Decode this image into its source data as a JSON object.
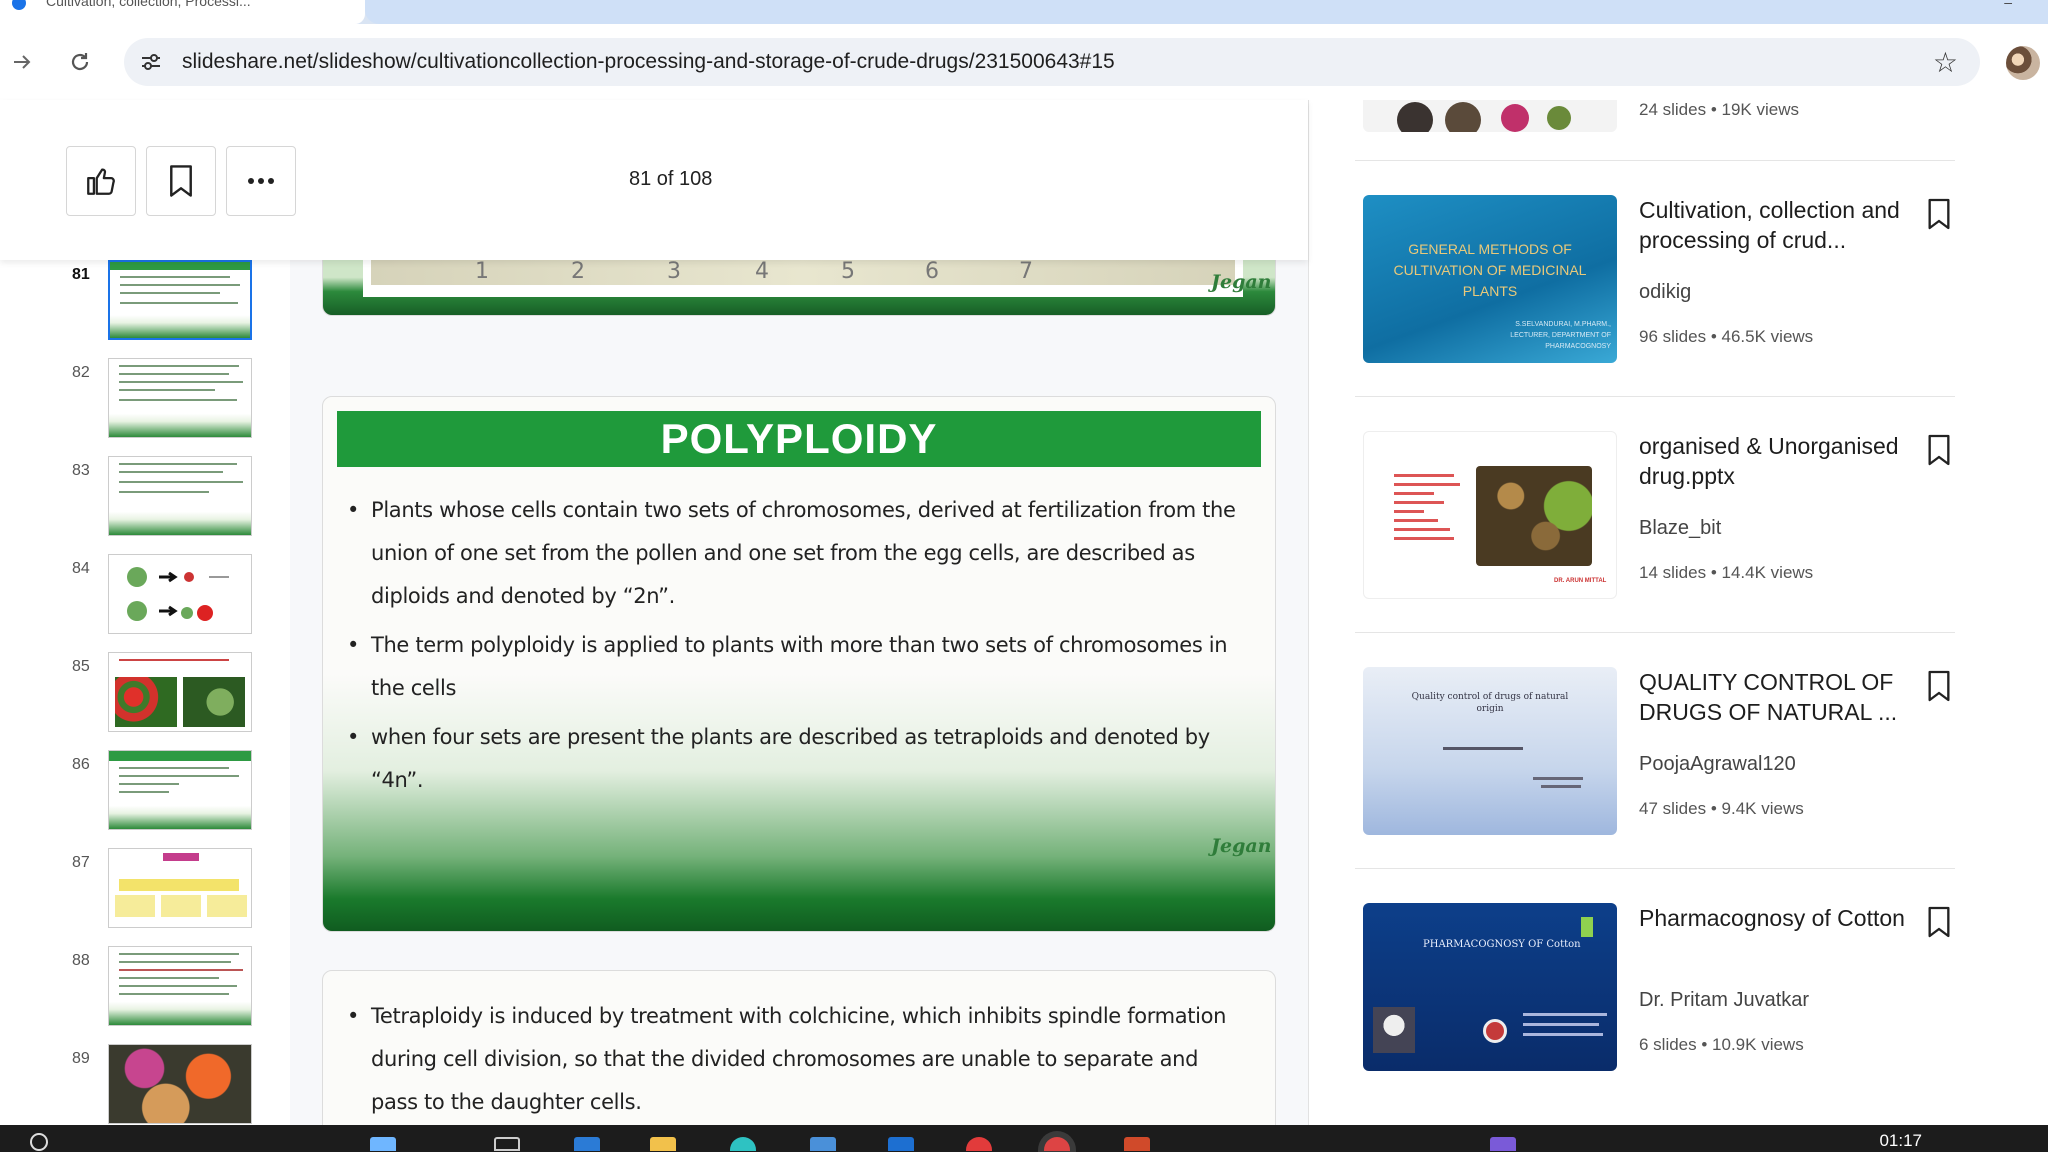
{
  "browser": {
    "tab_title": "Cultivation, collection, Processi...",
    "url": "slideshare.net/slideshow/cultivationcollection-processing-and-storage-of-crude-drugs/231500643#15"
  },
  "viewer": {
    "page_counter": "81 of 108",
    "thumbnails": [
      {
        "num": "81",
        "active": true
      },
      {
        "num": "82"
      },
      {
        "num": "83"
      },
      {
        "num": "84"
      },
      {
        "num": "85"
      },
      {
        "num": "86"
      },
      {
        "num": "87"
      },
      {
        "num": "88"
      },
      {
        "num": "89"
      }
    ]
  },
  "slides": {
    "prev": {
      "ticks": [
        "1",
        "2",
        "3",
        "4",
        "5",
        "6",
        "7"
      ],
      "signature": "Jegan"
    },
    "main": {
      "title": "POLYPLOIDY",
      "bullets": [
        "Plants whose cells contain two sets of chromosomes, derived at fertilization from the union of one set from the pollen and one set from the egg cells, are described as diploids and denoted by “2n”.",
        "The term polyploidy is applied to plants with more than two sets of chromosomes in the cells",
        "when four sets are present the plants are described as tetraploids and denoted by “4n”."
      ],
      "signature": "Jegan"
    },
    "next": {
      "bullets": [
        "Tetraploidy is induced by treatment with colchicine, which inhibits spindle formation during cell division, so that the divided chromosomes are unable to separate and pass to the daughter cells."
      ]
    }
  },
  "related": {
    "top_meta": {
      "slides": "24 slides",
      "views": "19K views"
    },
    "items": [
      {
        "title": "Cultivation, collection and processing of crud...",
        "author": "odikig",
        "slides": "96 slides",
        "views": "46.5K views",
        "thumb_text": "GENERAL METHODS OF CULTIVATION OF MEDICINAL PLANTS",
        "thumb_sub": "S.SELVANDURAI, M.PHARM., LECTURER, DEPARTMENT OF PHARMACOGNOSY"
      },
      {
        "title": "organised & Unorganised drug.pptx",
        "author": "Blaze_bit",
        "slides": "14 slides",
        "views": "14.4K views",
        "thumb_text": "",
        "thumb_sub": "DR. ARUN MITTAL"
      },
      {
        "title": "QUALITY CONTROL OF DRUGS OF NATURAL ...",
        "author": "PoojaAgrawal120",
        "slides": "47 slides",
        "views": "9.4K views",
        "thumb_text": "Quality control of drugs of natural origin",
        "thumb_sub": ""
      },
      {
        "title": "Pharmacognosy of Cotton",
        "author": "Dr. Pritam Juvatkar",
        "slides": "6 slides",
        "views": "10.9K views",
        "thumb_text": "PHARMACOGNOSY OF Cotton",
        "thumb_sub": ""
      }
    ]
  },
  "taskbar": {
    "clock": "01:17"
  },
  "colors": {
    "slide_green": "#1f9a3b",
    "accent_blue": "#1a73e8"
  }
}
